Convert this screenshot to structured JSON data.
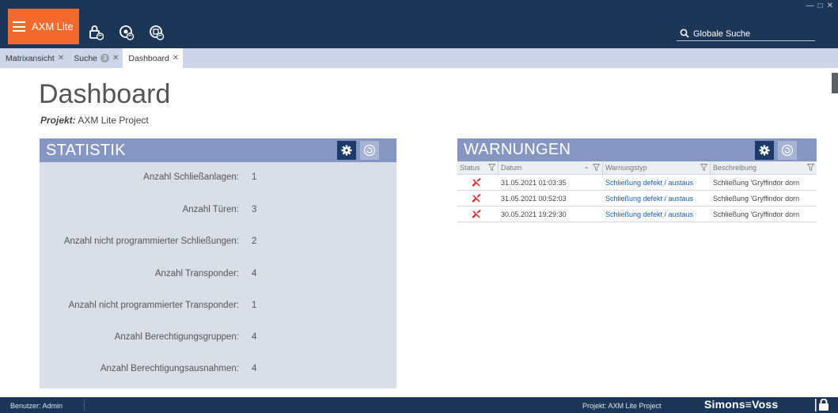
{
  "app": {
    "title": "AXM Lite"
  },
  "toolbar": {
    "icons": [
      "lock-sync-icon",
      "transponder-sync-icon",
      "card-sync-icon"
    ],
    "search_placeholder": "Globale Suche"
  },
  "tabs": [
    {
      "label": "Matrixansicht",
      "badge": ""
    },
    {
      "label": "Suche",
      "badge": "3"
    },
    {
      "label": "Dashboard",
      "badge": ""
    }
  ],
  "page": {
    "title": "Dashboard",
    "project_label": "Projekt:",
    "project_name": "AXM Lite Project"
  },
  "statistik": {
    "title": "STATISTIK",
    "rows": [
      {
        "label": "Anzahl Schließanlagen:",
        "value": "1"
      },
      {
        "label": "Anzahl Türen:",
        "value": "3"
      },
      {
        "label": "Anzahl nicht programmierter Schließungen:",
        "value": "2"
      },
      {
        "label": "Anzahl Transponder:",
        "value": "4"
      },
      {
        "label": "Anzahl nicht programmierter Transponder:",
        "value": "1"
      },
      {
        "label": "Anzahl Berechtigungsgruppen:",
        "value": "4"
      },
      {
        "label": "Anzahl Berechtigungsausnahmen:",
        "value": "4"
      }
    ]
  },
  "warnungen": {
    "title": "WARNUNGEN",
    "columns": [
      "Status",
      "Datum",
      "Warnungstyp",
      "Beschreibung"
    ],
    "rows": [
      {
        "datum": "31.05.2021 01:03:35",
        "typ": "Schließung defekt / austaus",
        "beschreibung": "Schließung 'Gryffindor dorn"
      },
      {
        "datum": "31.05.2021 00:52:03",
        "typ": "Schließung defekt / austaus",
        "beschreibung": "Schließung 'Gryffindor dorn"
      },
      {
        "datum": "30.05.2021 19:29:30",
        "typ": "Schließung defekt / austaus",
        "beschreibung": "Schließung 'Gryffindor dorn"
      }
    ]
  },
  "footer": {
    "user": "Benutzer: Admin",
    "project": "Projekt: AXM Lite Project",
    "brand": "Simons≡Voss"
  },
  "colors": {
    "topbar": "#1c3657",
    "brand_accent": "#f26a2e",
    "panel_header": "#8596c2",
    "panel_body": "#dadee6",
    "link": "#1a5fbf",
    "warning_icon": "#d9343a"
  }
}
